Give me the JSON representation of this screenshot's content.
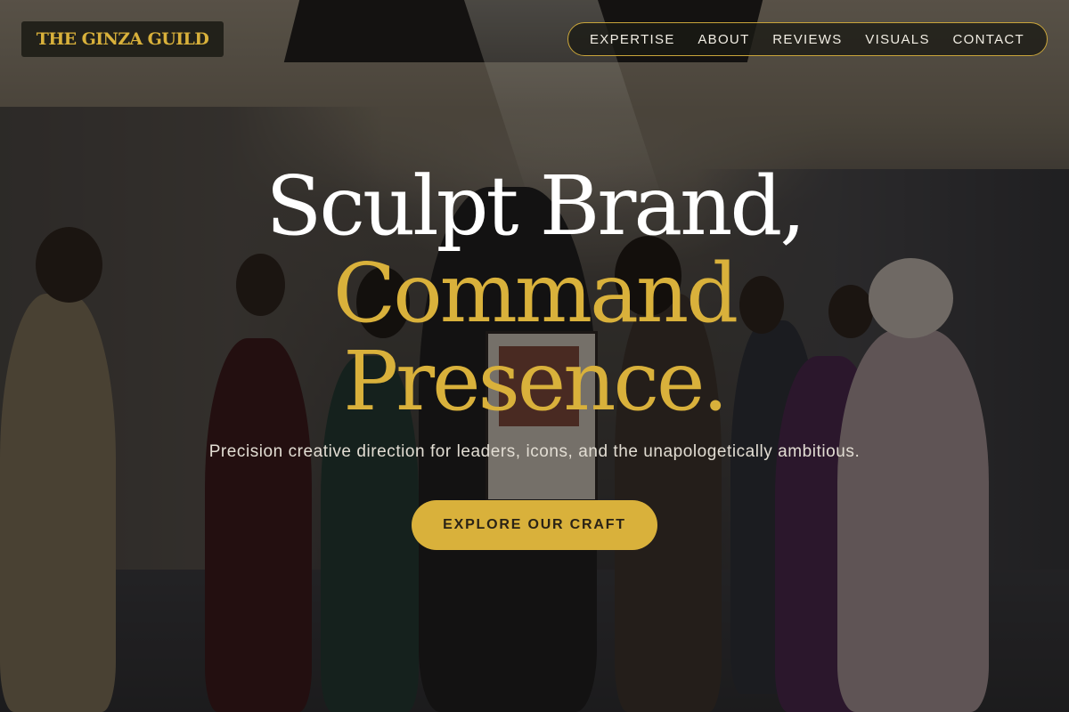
{
  "brand": {
    "logo_text": "THE GINZA GUILD"
  },
  "nav": {
    "items": [
      {
        "label": "EXPERTISE"
      },
      {
        "label": "ABOUT"
      },
      {
        "label": "REVIEWS"
      },
      {
        "label": "VISUALS"
      },
      {
        "label": "CONTACT"
      }
    ]
  },
  "hero": {
    "headline_line1": "Sculpt Brand,",
    "headline_line2": "Command",
    "headline_line3": "Presence.",
    "subtitle": "Precision creative direction for leaders, icons, and the unapologetically ambitious.",
    "cta_label": "EXPLORE OUR CRAFT"
  },
  "colors": {
    "accent_gold": "#d9b13b",
    "headline_white": "#ffffff",
    "nav_background": "#1a1914",
    "logo_background": "#22211a"
  }
}
